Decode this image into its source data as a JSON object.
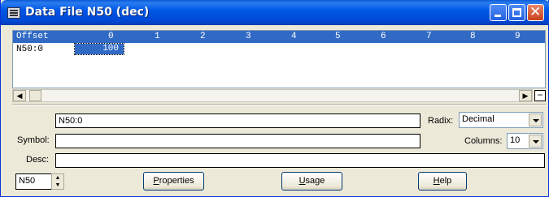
{
  "window": {
    "title": "Data File N50 (dec)"
  },
  "grid": {
    "header_label": "Offset",
    "columns": [
      "0",
      "1",
      "2",
      "3",
      "4",
      "5",
      "6",
      "7",
      "8",
      "9"
    ],
    "row_label": "N50:0",
    "cell_value": "100"
  },
  "address": {
    "value": "N50:0"
  },
  "radix": {
    "label": "Radix:",
    "value": "Decimal"
  },
  "symbol": {
    "label": "Symbol:",
    "value": ""
  },
  "columns_ctrl": {
    "label": "Columns:",
    "value": "10"
  },
  "desc": {
    "label": "Desc:",
    "value": ""
  },
  "file": {
    "value": "N50"
  },
  "buttons": {
    "properties": {
      "underlined": "P",
      "rest": "roperties"
    },
    "usage": {
      "underlined": "U",
      "rest": "sage"
    },
    "help": {
      "underlined": "H",
      "rest": "elp"
    }
  },
  "colors": {
    "titlebar": "#0058e6",
    "selection": "#316ac5",
    "face": "#ece9d8"
  }
}
